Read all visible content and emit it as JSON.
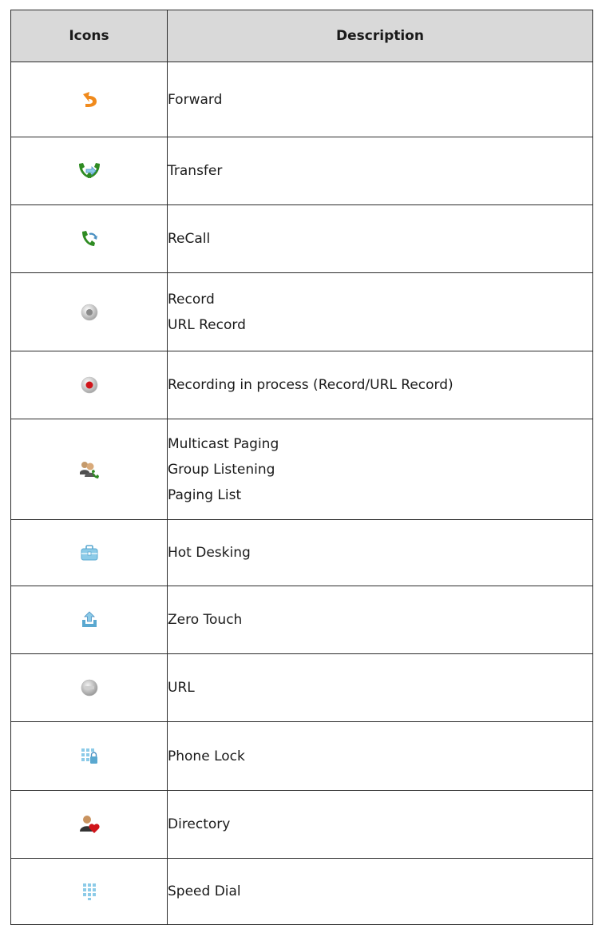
{
  "table": {
    "headers": {
      "icons": "Icons",
      "description": "Description"
    },
    "rows": [
      {
        "icon": "forward-icon",
        "lines": [
          "Forward"
        ]
      },
      {
        "icon": "transfer-icon",
        "lines": [
          "Transfer"
        ]
      },
      {
        "icon": "recall-icon",
        "lines": [
          "ReCall"
        ]
      },
      {
        "icon": "record-icon",
        "lines": [
          "Record",
          "URL Record"
        ]
      },
      {
        "icon": "recording-in-process-icon",
        "lines": [
          "Recording in process (Record/URL Record)"
        ]
      },
      {
        "icon": "paging-group-icon",
        "lines": [
          "Multicast Paging",
          "Group Listening",
          "Paging List"
        ]
      },
      {
        "icon": "hot-desking-icon",
        "lines": [
          "Hot Desking"
        ]
      },
      {
        "icon": "zero-touch-icon",
        "lines": [
          "Zero Touch"
        ]
      },
      {
        "icon": "url-icon",
        "lines": [
          "URL"
        ]
      },
      {
        "icon": "phone-lock-icon",
        "lines": [
          "Phone Lock"
        ]
      },
      {
        "icon": "directory-icon",
        "lines": [
          "Directory"
        ]
      },
      {
        "icon": "speed-dial-icon",
        "lines": [
          "Speed Dial"
        ]
      }
    ]
  },
  "colors": {
    "header_bg": "#d9d9d9",
    "border": "#2b2b2b",
    "forward_orange": "#f08a1c",
    "phone_green": "#2e8b22",
    "record_red": "#d0141a",
    "light_blue": "#8ccbe8"
  }
}
